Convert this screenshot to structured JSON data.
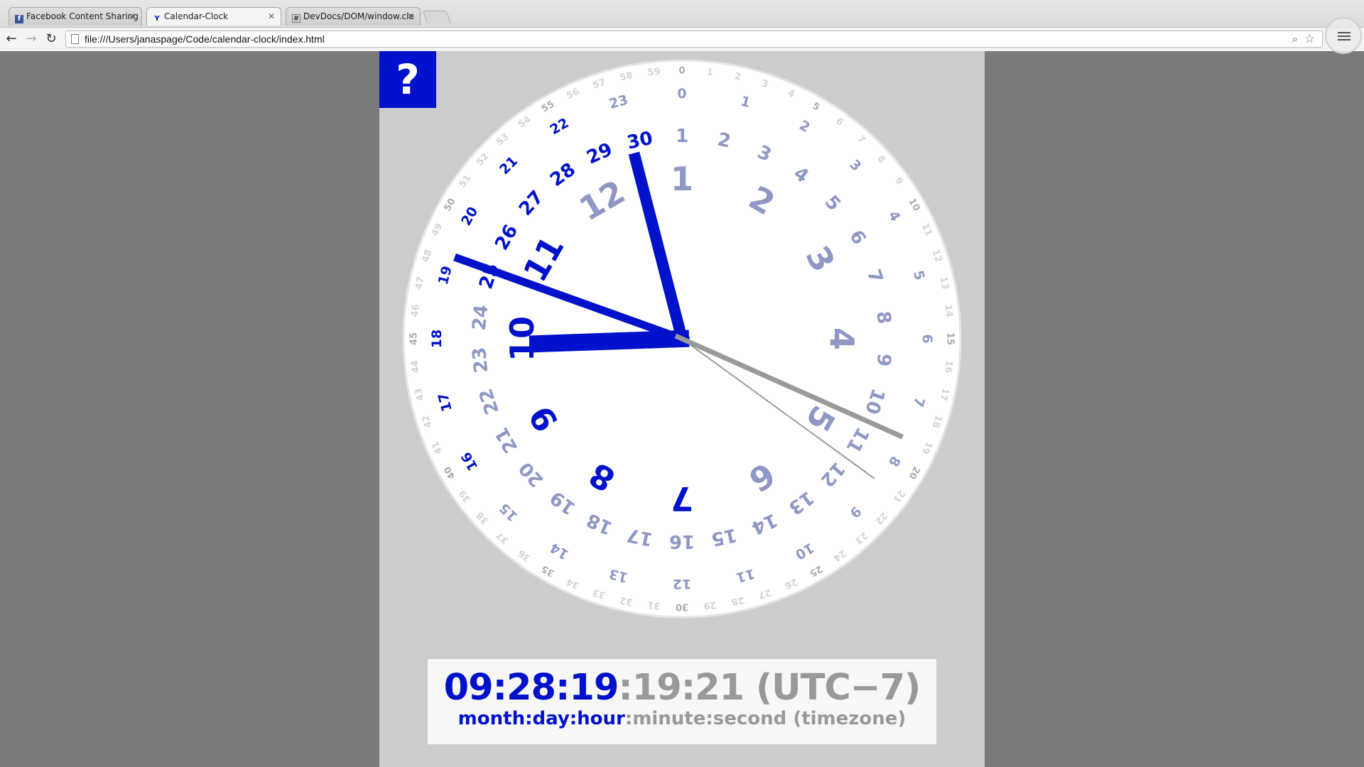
{
  "browser": {
    "tabs": [
      {
        "title": "Facebook Content Sharing",
        "icon": "facebook-icon"
      },
      {
        "title": "Calendar-Clock",
        "icon": "calendar-clock-icon"
      },
      {
        "title": "DevDocs/DOM/window.cle",
        "icon": "hash-icon"
      }
    ],
    "url": "file:///Users/janaspage/Code/calendar-clock/index.html"
  },
  "help_button": {
    "label": "?"
  },
  "clock": {
    "accent_color": "#0011cc",
    "faded_color": "#8f97c4",
    "grey_color": "#999999",
    "months_label": [
      "1",
      "2",
      "3",
      "4",
      "5",
      "6",
      "7",
      "8",
      "9",
      "10",
      "11",
      "12"
    ],
    "current": {
      "month": 9,
      "day": 28,
      "hour": 19,
      "minute": 19,
      "second": 21
    },
    "day_numbers_cw_from_top": [
      "1",
      "2",
      "3",
      "4",
      "5",
      "6",
      "7",
      "8",
      "9",
      "10",
      "11",
      "12",
      "13",
      "14",
      "15",
      "16",
      "17",
      "18",
      "19",
      "20",
      "21",
      "22",
      "23",
      "24",
      "25",
      "26",
      "27",
      "28",
      "29",
      "30"
    ],
    "hour_numbers": [
      "0",
      "1",
      "2",
      "3",
      "4",
      "5",
      "6",
      "7",
      "8",
      "9",
      "10",
      "11",
      "12",
      "13",
      "14",
      "15",
      "16",
      "17",
      "18",
      "19",
      "20",
      "21",
      "22",
      "23"
    ],
    "hand_colors": {
      "month": "#0011cc",
      "day": "#0011cc",
      "hour": "#0011cc",
      "minute": "#999999",
      "second": "#999999"
    }
  },
  "readout": {
    "time_primary": "09:28:19",
    "time_secondary": ":19:21 (UTC−7)",
    "label_primary": "month:day:hour",
    "label_secondary": ":minute:second (timezone)"
  }
}
